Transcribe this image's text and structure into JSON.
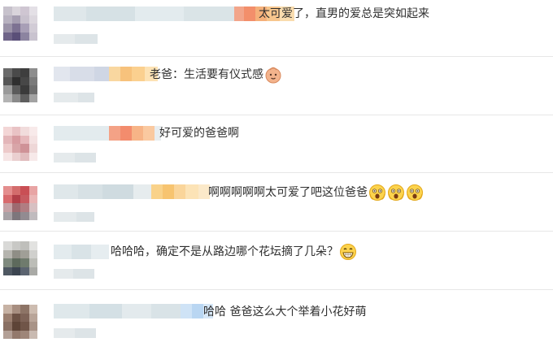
{
  "colors": {
    "text": "#2f2f2f",
    "divider": "#e6e6e6",
    "blur_light": "#dfe7ea",
    "blur_orange": "#f6b06a"
  },
  "comments": [
    {
      "text": "太可爱了，直男的爱总是突如起来",
      "emojis": []
    },
    {
      "text": "老爸：生活要有仪式感",
      "emojis": [
        "baby-face-icon"
      ]
    },
    {
      "text": "好可爱的爸爸啊",
      "emojis": []
    },
    {
      "text": "啊啊啊啊啊太可爱了吧这位爸爸",
      "emojis": [
        "shocked-face-icon",
        "shocked-face-icon",
        "shocked-face-icon"
      ]
    },
    {
      "text": "哈哈哈，确定不是从路边哪个花坛摘了几朵？",
      "emojis": [
        "grinning-face-icon"
      ]
    },
    {
      "text": "哈哈 爸爸这么大个举着小花好萌",
      "emojis": []
    }
  ]
}
